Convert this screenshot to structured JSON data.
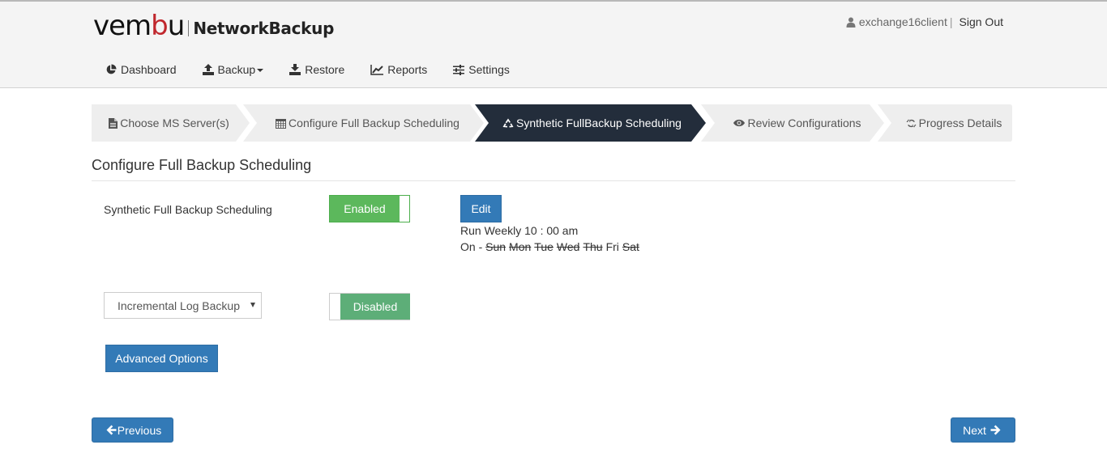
{
  "app": {
    "logo_text_black_1": "vem",
    "logo_text_red": "b",
    "logo_text_black_2": "u",
    "product_name": "NetworkBackup"
  },
  "user": {
    "icon": "user-icon",
    "username": "exchange16client",
    "separator": "|",
    "sign_out_label": "Sign Out"
  },
  "nav": {
    "items": [
      {
        "label": "Dashboard",
        "icon": "pie-chart-icon"
      },
      {
        "label": "Backup",
        "icon": "upload-icon",
        "has_dropdown": true
      },
      {
        "label": "Restore",
        "icon": "download-icon"
      },
      {
        "label": "Reports",
        "icon": "line-chart-icon"
      },
      {
        "label": "Settings",
        "icon": "sliders-icon"
      }
    ]
  },
  "wizard": {
    "steps": [
      {
        "label": "Choose MS Server(s)",
        "icon": "file-icon",
        "active": false
      },
      {
        "label": "Configure Full Backup Scheduling",
        "icon": "calendar-icon",
        "active": false
      },
      {
        "label": "Synthetic FullBackup Scheduling",
        "icon": "recycle-icon",
        "active": true
      },
      {
        "label": "Review Configurations",
        "icon": "eye-icon",
        "active": false
      },
      {
        "label": "Progress Details",
        "icon": "refresh-icon",
        "active": false
      }
    ],
    "colors": {
      "active": "#232d3b",
      "inactive": "#eeeeee"
    }
  },
  "main": {
    "section_title": "Configure Full Backup Scheduling",
    "synthetic": {
      "label": "Synthetic Full Backup Scheduling",
      "toggle_label": "Enabled",
      "toggle_state": true,
      "edit_label": "Edit",
      "schedule_line": "Run Weekly 10 : 00 am",
      "days_prefix": "On -",
      "days": [
        {
          "name": "Sun",
          "selected": false
        },
        {
          "name": "Mon",
          "selected": false
        },
        {
          "name": "Tue",
          "selected": false
        },
        {
          "name": "Wed",
          "selected": false
        },
        {
          "name": "Thu",
          "selected": false
        },
        {
          "name": "Fri",
          "selected": true
        },
        {
          "name": "Sat",
          "selected": false
        }
      ]
    },
    "incremental": {
      "select_value": "Incremental Log Backup",
      "toggle_label": "Disabled",
      "toggle_state": false
    },
    "advanced_options_label": "Advanced Options"
  },
  "footer": {
    "previous_label": "Previous",
    "next_label": "Next"
  },
  "colors": {
    "primary": "#337ab7",
    "success": "#5cb85c",
    "brand_red": "#c0272d"
  }
}
